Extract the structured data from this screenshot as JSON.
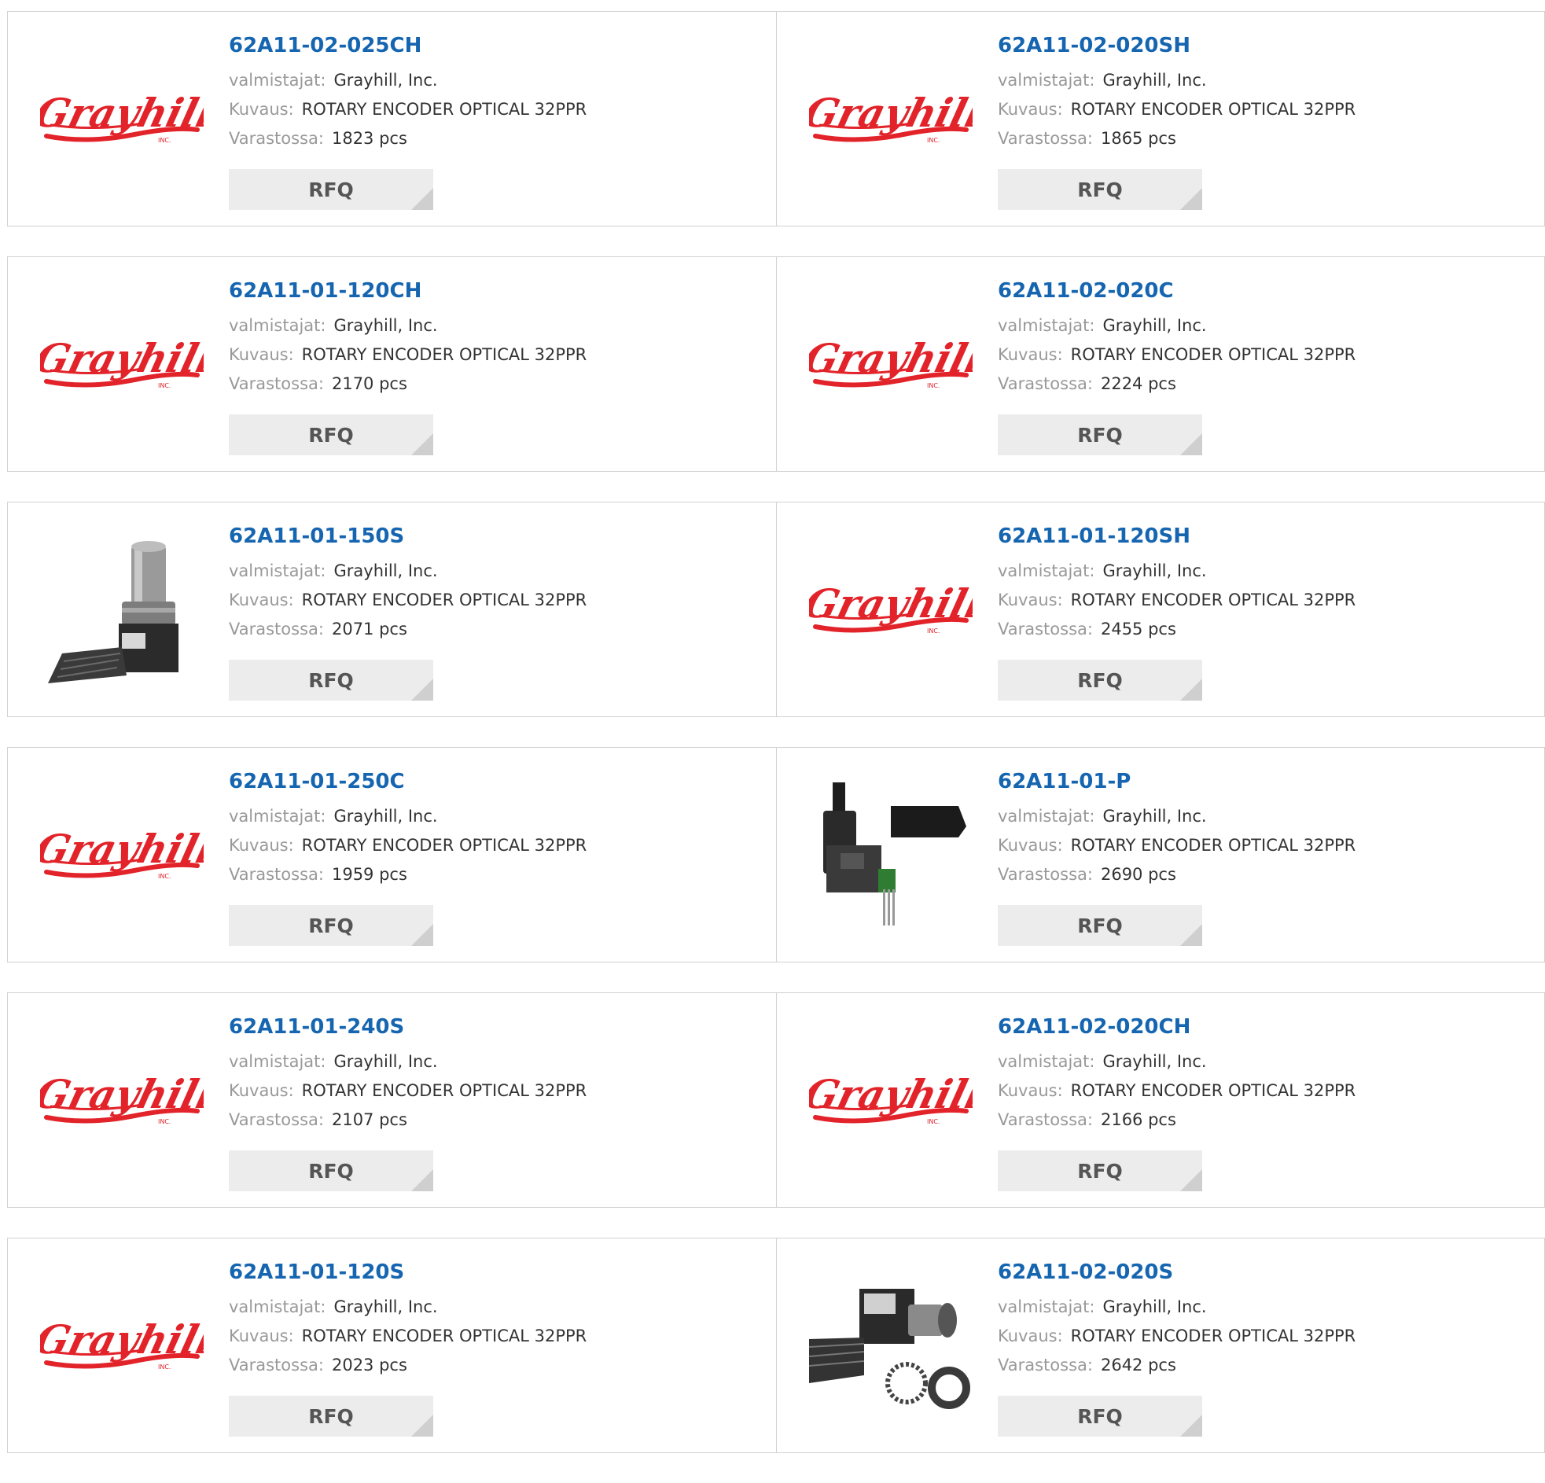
{
  "labels": {
    "manufacturer": "valmistajat:",
    "description": "Kuvaus:",
    "stock": "Varastossa:",
    "rfq": "RFQ"
  },
  "brand_logo_text": "Grayhill",
  "colors": {
    "part_number": "#1565b0",
    "logo_red": "#e2232a"
  },
  "products": [
    {
      "pn": "62A11-02-025CH",
      "mfr": "Grayhill, Inc.",
      "desc": "ROTARY ENCODER OPTICAL 32PPR",
      "stock": "1823 pcs",
      "image": "grayhill-logo"
    },
    {
      "pn": "62A11-02-020SH",
      "mfr": "Grayhill, Inc.",
      "desc": "ROTARY ENCODER OPTICAL 32PPR",
      "stock": "1865 pcs",
      "image": "grayhill-logo"
    },
    {
      "pn": "62A11-01-120CH",
      "mfr": "Grayhill, Inc.",
      "desc": "ROTARY ENCODER OPTICAL 32PPR",
      "stock": "2170 pcs",
      "image": "grayhill-logo"
    },
    {
      "pn": "62A11-02-020C",
      "mfr": "Grayhill, Inc.",
      "desc": "ROTARY ENCODER OPTICAL 32PPR",
      "stock": "2224 pcs",
      "image": "grayhill-logo"
    },
    {
      "pn": "62A11-01-150S",
      "mfr": "Grayhill, Inc.",
      "desc": "ROTARY ENCODER OPTICAL 32PPR",
      "stock": "2071 pcs",
      "image": "encoder-ribbon-photo"
    },
    {
      "pn": "62A11-01-120SH",
      "mfr": "Grayhill, Inc.",
      "desc": "ROTARY ENCODER OPTICAL 32PPR",
      "stock": "2455 pcs",
      "image": "grayhill-logo"
    },
    {
      "pn": "62A11-01-250C",
      "mfr": "Grayhill, Inc.",
      "desc": "ROTARY ENCODER OPTICAL 32PPR",
      "stock": "1959 pcs",
      "image": "grayhill-logo"
    },
    {
      "pn": "62A11-01-P",
      "mfr": "Grayhill, Inc.",
      "desc": "ROTARY ENCODER OPTICAL 32PPR",
      "stock": "2690 pcs",
      "image": "encoder-pins-photo"
    },
    {
      "pn": "62A11-01-240S",
      "mfr": "Grayhill, Inc.",
      "desc": "ROTARY ENCODER OPTICAL 32PPR",
      "stock": "2107 pcs",
      "image": "grayhill-logo"
    },
    {
      "pn": "62A11-02-020CH",
      "mfr": "Grayhill, Inc.",
      "desc": "ROTARY ENCODER OPTICAL 32PPR",
      "stock": "2166 pcs",
      "image": "grayhill-logo"
    },
    {
      "pn": "62A11-01-120S",
      "mfr": "Grayhill, Inc.",
      "desc": "ROTARY ENCODER OPTICAL 32PPR",
      "stock": "2023 pcs",
      "image": "grayhill-logo"
    },
    {
      "pn": "62A11-02-020S",
      "mfr": "Grayhill, Inc.",
      "desc": "ROTARY ENCODER OPTICAL 32PPR",
      "stock": "2642 pcs",
      "image": "encoder-nut-photo"
    }
  ]
}
